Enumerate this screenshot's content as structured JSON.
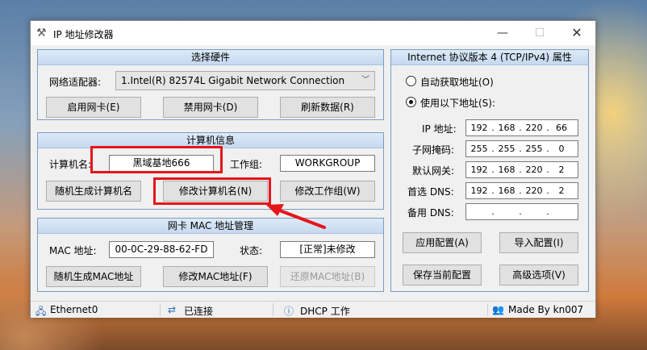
{
  "window": {
    "title": "IP 地址修改器"
  },
  "hardware": {
    "header": "选择硬件",
    "adapter_label": "网络适配器:",
    "adapter_value": "1.Intel(R) 82574L Gigabit Network Connection",
    "enable_btn": "启用网卡(E)",
    "disable_btn": "禁用网卡(D)",
    "refresh_btn": "刷新数据(R)"
  },
  "computer": {
    "header": "计算机信息",
    "name_label": "计算机名:",
    "name_value": "黑域基地666",
    "workgroup_label": "工作组:",
    "workgroup_value": "WORKGROUP",
    "random_btn": "随机生成计算机名",
    "modify_name_btn": "修改计算机名(N)",
    "modify_group_btn": "修改工作组(W)"
  },
  "mac": {
    "header": "网卡 MAC 地址管理",
    "mac_label": "MAC 地址:",
    "mac_value": "00-0C-29-88-62-FD",
    "status_label": "状态:",
    "status_value": "[正常]未修改",
    "random_btn": "随机生成MAC地址",
    "modify_btn": "修改MAC地址(F)",
    "restore_btn": "还原MAC地址(B)"
  },
  "ipv4": {
    "header": "Internet 协议版本 4 (TCP/IPv4) 属性",
    "auto_label": "自动获取地址(O)",
    "manual_label": "使用以下地址(S):",
    "ip_label": "IP 地址:",
    "ip": [
      "192",
      "168",
      "220",
      "66"
    ],
    "mask_label": "子网掩码:",
    "mask": [
      "255",
      "255",
      "255",
      "0"
    ],
    "gateway_label": "默认网关:",
    "gateway": [
      "192",
      "168",
      "220",
      "2"
    ],
    "dns1_label": "首选 DNS:",
    "dns1": [
      "192",
      "168",
      "220",
      "2"
    ],
    "dns2_label": "备用 DNS:",
    "dns2": [
      "",
      "",
      "",
      ""
    ],
    "apply_btn": "应用配置(A)",
    "import_btn": "导入配置(I)",
    "save_btn": "保存当前配置",
    "advanced_btn": "高级选项(V)"
  },
  "status": {
    "adapter": "Ethernet0",
    "connection": "已连接",
    "mode": "DHCP 工作",
    "author": "Made By kn007"
  },
  "colors": {
    "annotation": "#e5151b",
    "panel_border": "#7a9cc4"
  },
  "icons": [
    "tools-icon",
    "minimize-icon",
    "maximize-icon",
    "close-icon",
    "chevron-down-icon",
    "network-icon",
    "plug-icon",
    "info-icon",
    "users-icon",
    "arrow-icon"
  ]
}
